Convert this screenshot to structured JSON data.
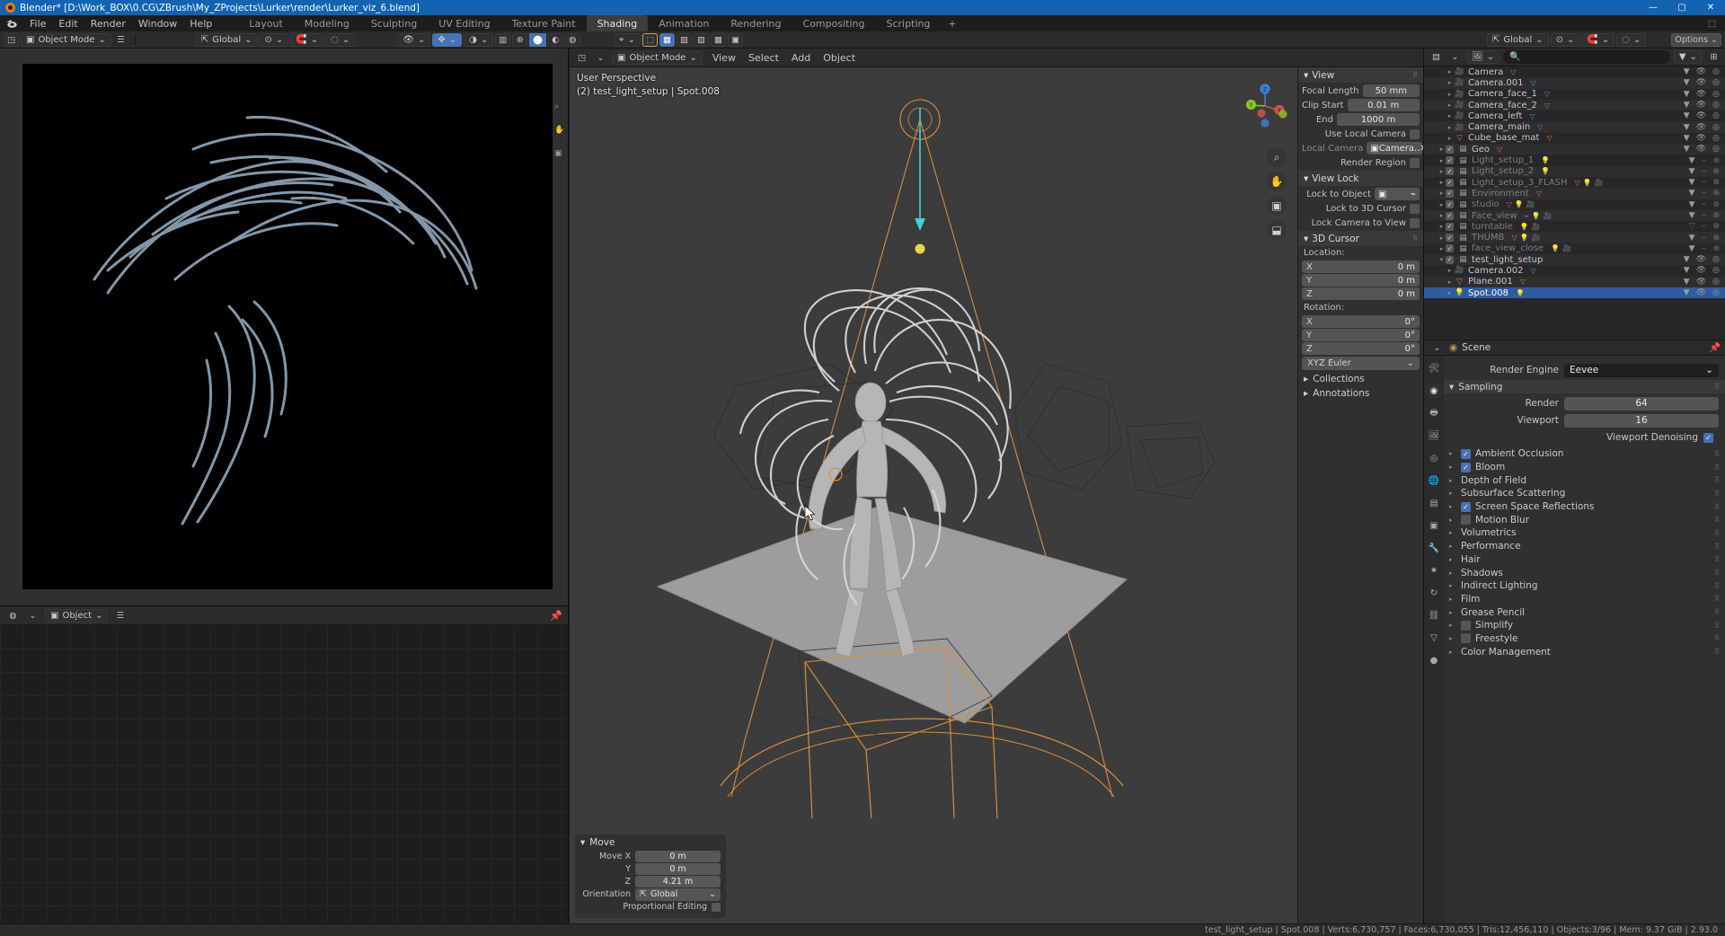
{
  "window": {
    "title": "Blender* [D:\\Work_BOX\\0.CG\\ZBrush\\My_ZProjects\\Lurker\\render\\Lurker_viz_6.blend]",
    "minimize": "—",
    "maximize": "▢",
    "close": "✕"
  },
  "menus": [
    "File",
    "Edit",
    "Render",
    "Window",
    "Help"
  ],
  "workspace_tabs": [
    {
      "label": "Layout",
      "active": false
    },
    {
      "label": "Modeling",
      "active": false
    },
    {
      "label": "Sculpting",
      "active": false
    },
    {
      "label": "UV Editing",
      "active": false
    },
    {
      "label": "Texture Paint",
      "active": false
    },
    {
      "label": "Shading",
      "active": true
    },
    {
      "label": "Animation",
      "active": false
    },
    {
      "label": "Rendering",
      "active": false
    },
    {
      "label": "Compositing",
      "active": false
    },
    {
      "label": "Scripting",
      "active": false
    },
    {
      "label": "+",
      "active": false
    }
  ],
  "toolbar": {
    "mode": "Object Mode",
    "transform_orientation": "Global",
    "options": "Options"
  },
  "image_editor": {
    "mode": "Object",
    "pin": "pin-icon"
  },
  "viewport": {
    "header_mode": "Object Mode",
    "menus": [
      "View",
      "Select",
      "Add",
      "Object"
    ],
    "orientation": "Global",
    "info_line1": "User Perspective",
    "info_line2": "(2) test_light_setup | Spot.008"
  },
  "n_panel": {
    "view": {
      "section": "View",
      "rows": [
        {
          "label": "Focal Length",
          "value": "50 mm"
        },
        {
          "label": "Clip Start",
          "value": "0.01 m"
        },
        {
          "label": "End",
          "value": "1000 m"
        }
      ],
      "use_local_camera": {
        "label": "Use Local Camera",
        "checked": false
      },
      "local_camera": {
        "label": "Local Camera",
        "value": "Camera.."
      },
      "render_region": {
        "label": "Render Region",
        "checked": false
      }
    },
    "view_lock": {
      "section": "View Lock",
      "lock_to_object": {
        "label": "Lock to Object",
        "value": ""
      },
      "lock_to_3d_cursor": {
        "label": "Lock to 3D Cursor",
        "checked": false
      },
      "lock_camera_to_view": {
        "label": "Lock Camera to View",
        "checked": false
      }
    },
    "cursor": {
      "section": "3D Cursor",
      "location_label": "Location:",
      "location": [
        {
          "axis": "X",
          "value": "0 m"
        },
        {
          "axis": "Y",
          "value": "0 m"
        },
        {
          "axis": "Z",
          "value": "0 m"
        }
      ],
      "rotation_label": "Rotation:",
      "rotation": [
        {
          "axis": "X",
          "value": "0°"
        },
        {
          "axis": "Y",
          "value": "0°"
        },
        {
          "axis": "Z",
          "value": "0°"
        }
      ],
      "rotation_mode": "XYZ Euler"
    },
    "collapsed": [
      {
        "label": "Collections"
      },
      {
        "label": "Annotations"
      }
    ]
  },
  "gizmo": {
    "axes": [
      {
        "label": "Z",
        "color": "#3b7fd4"
      },
      {
        "label": "Y",
        "color": "#88c02f"
      },
      {
        "label": "X",
        "color": "#d0504a"
      }
    ]
  },
  "view_tools": [
    {
      "name": "zoom-icon",
      "glyph": "⌕"
    },
    {
      "name": "pan-hand-icon",
      "glyph": "✋"
    },
    {
      "name": "camera-view-icon",
      "glyph": "🎥"
    },
    {
      "name": "ortho-persp-icon",
      "glyph": "⬓"
    }
  ],
  "move_operator": {
    "title": "Move",
    "rows": [
      {
        "label": "Move X",
        "value": "0 m"
      },
      {
        "label": "Y",
        "value": "0 m"
      },
      {
        "label": "Z",
        "value": "4.21 m"
      }
    ],
    "orientation_label": "Orientation",
    "orientation_value": "Global",
    "proportional_label": "Proportional Editing",
    "proportional_checked": false
  },
  "outliner": {
    "search_placeholder": "",
    "rows": [
      {
        "name": "Camera",
        "type": "camera",
        "indent": 2,
        "expandable": true,
        "checkbox": false,
        "dim": false,
        "selected": false,
        "badges": [
          "data"
        ],
        "right": [
          "filter",
          "eye",
          "camera"
        ]
      },
      {
        "name": "Camera.001",
        "type": "camera",
        "indent": 2,
        "expandable": true,
        "checkbox": false,
        "dim": false,
        "selected": false,
        "badges": [
          "data"
        ],
        "right": [
          "filter",
          "eye",
          "camera"
        ]
      },
      {
        "name": "Camera_face_1",
        "type": "camera",
        "indent": 2,
        "expandable": true,
        "checkbox": false,
        "dim": false,
        "selected": false,
        "badges": [
          "data"
        ],
        "right": [
          "filter",
          "eye",
          "camera"
        ]
      },
      {
        "name": "Camera_face_2",
        "type": "camera",
        "indent": 2,
        "expandable": true,
        "checkbox": false,
        "dim": false,
        "selected": false,
        "badges": [
          "data"
        ],
        "right": [
          "filter",
          "eye",
          "camera"
        ]
      },
      {
        "name": "Camera_left",
        "type": "camera",
        "indent": 2,
        "expandable": true,
        "checkbox": false,
        "dim": false,
        "selected": false,
        "badges": [
          "data"
        ],
        "right": [
          "filter",
          "eye",
          "camera"
        ]
      },
      {
        "name": "Camera_main",
        "type": "camera",
        "indent": 2,
        "expandable": true,
        "checkbox": false,
        "dim": false,
        "selected": false,
        "badges": [
          "data"
        ],
        "right": [
          "filter",
          "eye",
          "camera"
        ]
      },
      {
        "name": "Cube_base_mat",
        "type": "mesh",
        "indent": 2,
        "expandable": true,
        "checkbox": false,
        "dim": false,
        "selected": false,
        "badges": [
          "meshdata"
        ],
        "right": [
          "filter",
          "eye",
          "camera"
        ]
      },
      {
        "name": "Geo",
        "type": "collection",
        "indent": 1,
        "expandable": true,
        "checkbox": true,
        "dim": false,
        "selected": false,
        "badges": [
          "mesh5"
        ],
        "right": [
          "filter",
          "eye",
          "camera"
        ]
      },
      {
        "name": "Light_setup_1",
        "type": "collection",
        "indent": 1,
        "expandable": true,
        "checkbox": true,
        "dim": true,
        "selected": false,
        "badges": [
          "light3"
        ],
        "right": [
          "filter",
          "eyeoff",
          "camoff"
        ]
      },
      {
        "name": "Light_setup_2",
        "type": "collection",
        "indent": 1,
        "expandable": true,
        "checkbox": true,
        "dim": true,
        "selected": false,
        "badges": [
          "light2"
        ],
        "right": [
          "filter",
          "eyeoff",
          "camoff"
        ]
      },
      {
        "name": "Light_setup_3_FLASH",
        "type": "collection",
        "indent": 1,
        "expandable": true,
        "checkbox": true,
        "dim": true,
        "selected": false,
        "badges": [
          "mesh",
          "light5",
          "cam"
        ],
        "right": [
          "filter",
          "eyeoff",
          "camoff"
        ]
      },
      {
        "name": "Environment",
        "type": "collection",
        "indent": 1,
        "expandable": true,
        "checkbox": true,
        "dim": true,
        "selected": false,
        "badges": [
          "mesh26"
        ],
        "right": [
          "filter",
          "eyeoff",
          "camoff"
        ]
      },
      {
        "name": "studio",
        "type": "collection",
        "indent": 1,
        "expandable": true,
        "checkbox": true,
        "dim": true,
        "selected": false,
        "badges": [
          "mesh6",
          "light",
          "cam"
        ],
        "right": [
          "filter",
          "eyeoff",
          "camoff"
        ]
      },
      {
        "name": "Face_view",
        "type": "collection",
        "indent": 1,
        "expandable": true,
        "checkbox": true,
        "dim": true,
        "selected": false,
        "badges": [
          "empty",
          "light3",
          "cam3"
        ],
        "right": [
          "filter",
          "eyeoff",
          "camoff"
        ]
      },
      {
        "name": "turntable",
        "type": "collection",
        "indent": 1,
        "expandable": true,
        "checkbox": true,
        "dim": true,
        "selected": false,
        "badges": [
          "light3",
          "cam"
        ],
        "right": [
          "filteroff",
          "eyeoff",
          "camoff"
        ]
      },
      {
        "name": "THUMB",
        "type": "collection",
        "indent": 1,
        "expandable": true,
        "checkbox": true,
        "dim": true,
        "selected": false,
        "badges": [
          "mesh",
          "light",
          "cam"
        ],
        "right": [
          "filter",
          "eyeoff",
          "camoff"
        ]
      },
      {
        "name": "face_view_close",
        "type": "collection",
        "indent": 1,
        "expandable": true,
        "checkbox": true,
        "dim": true,
        "selected": false,
        "badges": [
          "light4",
          "cam"
        ],
        "right": [
          "filter",
          "eyeoff",
          "camoff"
        ]
      },
      {
        "name": "test_light_setup",
        "type": "collection",
        "indent": 1,
        "expandable": true,
        "expanded": true,
        "checkbox": true,
        "dim": false,
        "selected": false,
        "badges": [],
        "right": [
          "filter",
          "eye",
          "camera"
        ]
      },
      {
        "name": "Camera.002",
        "type": "camera",
        "indent": 2,
        "expandable": true,
        "checkbox": false,
        "dim": false,
        "selected": false,
        "badges": [
          "data"
        ],
        "right": [
          "filter",
          "eye",
          "camera"
        ]
      },
      {
        "name": "Plane.001",
        "type": "mesh",
        "indent": 2,
        "expandable": true,
        "checkbox": false,
        "dim": false,
        "selected": false,
        "badges": [
          "meshdata"
        ],
        "right": [
          "filter",
          "eye",
          "camera"
        ]
      },
      {
        "name": "Spot.008",
        "type": "light",
        "indent": 2,
        "expandable": true,
        "checkbox": false,
        "dim": false,
        "selected": true,
        "badges": [
          "lightdata"
        ],
        "right": [
          "filter",
          "eye",
          "camera"
        ]
      }
    ]
  },
  "scene_bar": {
    "label": "Scene"
  },
  "properties": {
    "breadcrumb": "Scene",
    "render_engine_label": "Render Engine",
    "render_engine_value": "Eevee",
    "sampling": {
      "title": "Sampling",
      "rows": [
        {
          "label": "Render",
          "value": "64"
        },
        {
          "label": "Viewport",
          "value": "16"
        }
      ],
      "denoising_label": "Viewport Denoising",
      "denoising_checked": true
    },
    "sections": [
      {
        "label": "Ambient Occlusion",
        "checkbox": true,
        "checked": true
      },
      {
        "label": "Bloom",
        "checkbox": true,
        "checked": true
      },
      {
        "label": "Depth of Field",
        "checkbox": false,
        "checked": false
      },
      {
        "label": "Subsurface Scattering",
        "checkbox": false,
        "checked": false
      },
      {
        "label": "Screen Space Reflections",
        "checkbox": true,
        "checked": true
      },
      {
        "label": "Motion Blur",
        "checkbox": true,
        "checked": false
      },
      {
        "label": "Volumetrics",
        "checkbox": false,
        "checked": false
      },
      {
        "label": "Performance",
        "checkbox": false,
        "checked": false
      },
      {
        "label": "Hair",
        "checkbox": false,
        "checked": false
      },
      {
        "label": "Shadows",
        "checkbox": false,
        "checked": false
      },
      {
        "label": "Indirect Lighting",
        "checkbox": false,
        "checked": false
      },
      {
        "label": "Film",
        "checkbox": false,
        "checked": false
      },
      {
        "label": "Grease Pencil",
        "checkbox": false,
        "checked": false
      },
      {
        "label": "Simplify",
        "checkbox": true,
        "checked": false
      },
      {
        "label": "Freestyle",
        "checkbox": true,
        "checked": false
      },
      {
        "label": "Color Management",
        "checkbox": false,
        "checked": false
      }
    ],
    "tabs": [
      {
        "name": "tool-tab",
        "glyph": "🛠"
      },
      {
        "name": "render-tab",
        "glyph": "◉"
      },
      {
        "name": "output-tab",
        "glyph": "🖶"
      },
      {
        "name": "view-layer-tab",
        "glyph": "🖼"
      },
      {
        "name": "scene-tab",
        "glyph": "◎"
      },
      {
        "name": "world-tab",
        "glyph": "🌐"
      },
      {
        "name": "collection-tab",
        "glyph": "▤"
      },
      {
        "name": "object-tab",
        "glyph": "▣"
      },
      {
        "name": "modifier-tab",
        "glyph": "🔧"
      },
      {
        "name": "particles-tab",
        "glyph": "✷"
      },
      {
        "name": "physics-tab",
        "glyph": "↻"
      },
      {
        "name": "constraints-tab",
        "glyph": "⛓"
      },
      {
        "name": "data-tab",
        "glyph": "▽"
      },
      {
        "name": "material-tab",
        "glyph": "●"
      }
    ]
  },
  "status_bar": {
    "left": "",
    "right": "test_light_setup | Spot.008   |   Verts:6,730,757   |   Faces:6,730,055   |   Tris:12,456,110   |   Objects:3/96   |   Mem: 9.37 GiB   |   2.93.0"
  }
}
